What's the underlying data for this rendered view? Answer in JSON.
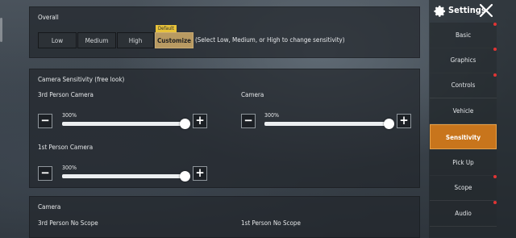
{
  "overall": {
    "title": "Overall",
    "options": [
      "Low",
      "Medium",
      "High",
      "Customize"
    ],
    "selected": "Customize",
    "default_tag": "Default",
    "hint": "(Select Low, Medium, or High to change sensitivity)"
  },
  "camera_free_look": {
    "title": "Camera Sensitivity (free look)",
    "third_person": {
      "label": "3rd Person Camera",
      "value_text": "300%",
      "level": 1.0
    },
    "camera": {
      "label": "Camera",
      "value_text": "300%",
      "level": 1.0
    },
    "first_person": {
      "label": "1st Person Camera",
      "value_text": "300%",
      "level": 1.0
    }
  },
  "camera_section": {
    "title": "Camera",
    "third_no_scope": "3rd Person No Scope",
    "first_no_scope": "1st Person No Scope"
  },
  "sidebar": {
    "title": "Settings",
    "items": [
      {
        "label": "Basic",
        "badge": true
      },
      {
        "label": "Graphics",
        "badge": true
      },
      {
        "label": "Controls",
        "badge": true
      },
      {
        "label": "Vehicle",
        "badge": false
      },
      {
        "label": "Sensitivity",
        "badge": false,
        "active": true
      },
      {
        "label": "Pick Up",
        "badge": false
      },
      {
        "label": "Scope",
        "badge": true
      },
      {
        "label": "Audio",
        "badge": true
      }
    ]
  },
  "controls": {
    "minus": "−",
    "plus": "+"
  },
  "colors": {
    "accent": "#c8751c",
    "selected_segment": "#b89a62",
    "badge": "#e13434"
  }
}
